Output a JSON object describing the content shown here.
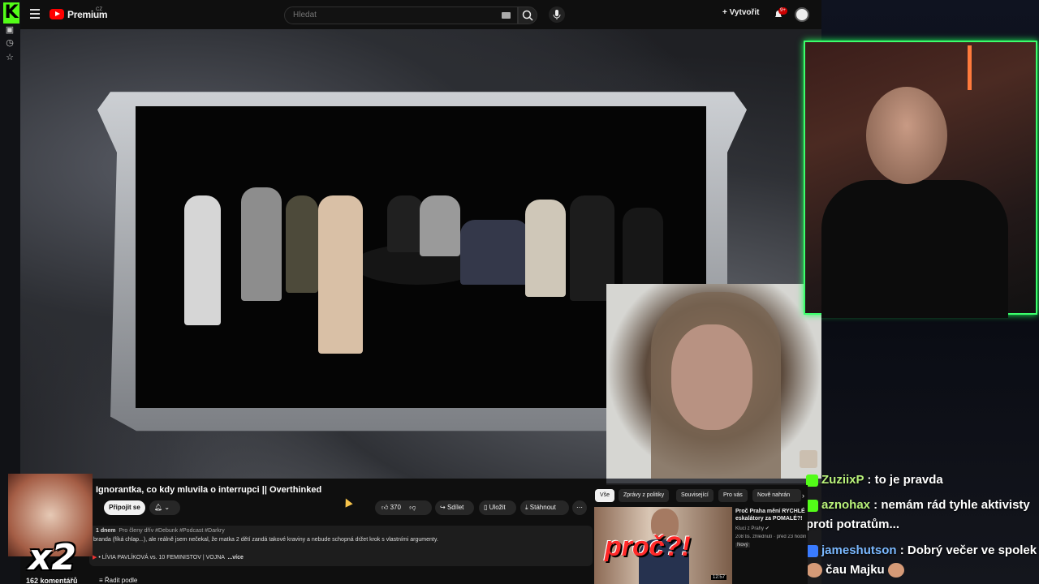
{
  "kick": {
    "logo": "K"
  },
  "youtube": {
    "brand": "Premium",
    "brand_region": "CZ",
    "search_placeholder": "Hledat",
    "create_label": "Vytvořit",
    "notification_count": "9+"
  },
  "video": {
    "title": "Ignorantka, co kdy mluvila o interrupci || Overthinked",
    "join_label": "Připojit se",
    "likes": "370",
    "share_label": "Sdílet",
    "save_label": "Uložit",
    "download_label": "Stáhnout",
    "uploaded": "1 dnem",
    "members_early": "Pro členy dřív",
    "hashtags": "#Debunk #Podcast #Darkry",
    "description": "branda (fíká chlap...), ale reálně jsem nečekal, že matka 2 dětí zandá takové kraviny a nebude schopná držet krok s vlastními argumenty.",
    "linked_video": "LÍVIA PAVLÍKOVÁ vs. 10 FEMINISTOV | VOJNA",
    "more_label": "...více",
    "comments_count": "162 komentářů",
    "sort_label": "Řadit podle"
  },
  "recs": {
    "chips": [
      "Vše",
      "Zprávy z politiky",
      "Související",
      "Pro vás",
      "Nově nahrán"
    ],
    "item_title": "Proč Praha mění RYCHLÉ eskalátory za POMALÉ?!",
    "item_channel": "Kluci z Prahy",
    "item_meta": "208 tis. zhlédnutí · před 23 hodin",
    "item_badge": "Nový",
    "thumb_text": "proč?!",
    "duration": "12:57"
  },
  "overlay": {
    "multiplier": "x2"
  },
  "chat": [
    {
      "user": "ZuziixP",
      "color": "#b9f27a",
      "text": " : to je pravda"
    },
    {
      "user": "aznohax",
      "color": "#b9f27a",
      "text": " : nemám rád tyhle aktivisty proti potratům..."
    },
    {
      "user": "jameshutson",
      "color": "#7ab8ff",
      "text": " : Dobrý večer ve spolek",
      "tail": "čau Majku"
    }
  ]
}
